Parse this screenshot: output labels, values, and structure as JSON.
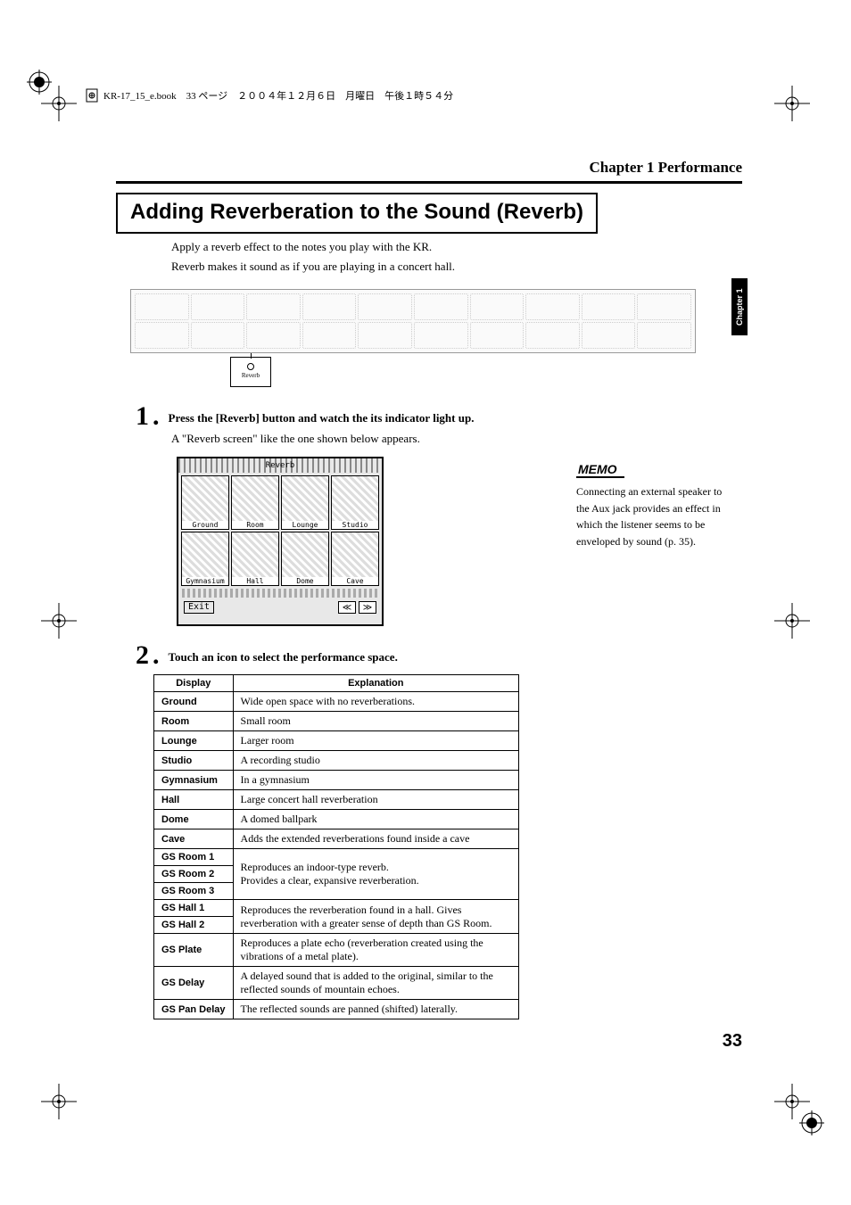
{
  "header_line": "KR-17_15_e.book　33 ページ　２００４年１２月６日　月曜日　午後１時５４分",
  "chapter_heading": "Chapter 1 Performance",
  "main_title": "Adding Reverberation to the Sound (Reverb)",
  "intro_lines": [
    "Apply a reverb effect to the notes you play with the KR.",
    "Reverb makes it sound as if you are playing in a concert hall."
  ],
  "reverb_button_label": "Reverb",
  "steps": {
    "s1_num": "1",
    "s1_text": "Press the [Reverb] button and watch the its indicator light up.",
    "s1_sub": "A \"Reverb screen\" like the one shown below appears.",
    "s2_num": "2",
    "s2_text": "Touch an icon to select the performance space."
  },
  "reverb_screen": {
    "title": "Reverb",
    "cells": [
      "Ground",
      "Room",
      "Lounge",
      "Studio",
      "Gymnasium",
      "Hall",
      "Dome",
      "Cave"
    ],
    "exit": "Exit",
    "prev": "≪",
    "next": "≫"
  },
  "table": {
    "headers": {
      "display": "Display",
      "explanation": "Explanation"
    },
    "rows": [
      {
        "d": "Ground",
        "e": "Wide open space with no reverberations."
      },
      {
        "d": "Room",
        "e": "Small room"
      },
      {
        "d": "Lounge",
        "e": "Larger room"
      },
      {
        "d": "Studio",
        "e": "A recording studio"
      },
      {
        "d": "Gymnasium",
        "e": "In a gymnasium"
      },
      {
        "d": "Hall",
        "e": "Large concert hall reverberation"
      },
      {
        "d": "Dome",
        "e": "A domed ballpark"
      },
      {
        "d": "Cave",
        "e": "Adds the extended reverberations found inside a cave"
      }
    ],
    "gs_group": {
      "rooms": [
        "GS Room 1",
        "GS Room 2",
        "GS Room 3"
      ],
      "rooms_expl": "Reproduces an indoor-type reverb.\nProvides a clear, expansive reverberation.",
      "halls": [
        "GS Hall 1",
        "GS Hall 2"
      ],
      "halls_expl": "Reproduces the reverberation found in a hall. Gives reverberation with a greater sense of depth than GS Room.",
      "plate_d": "GS Plate",
      "plate_e": "Reproduces a plate echo (reverberation created using the vibrations of a metal plate).",
      "delay_d": "GS Delay",
      "delay_e": "A delayed sound that is added to the original, similar to the reflected sounds of mountain echoes.",
      "pan_d": "GS Pan Delay",
      "pan_e": "The reflected sounds are panned (shifted) laterally."
    }
  },
  "memo": {
    "label": "MEMO",
    "text": "Connecting an external speaker to the Aux jack provides an effect in which the listener seems to be enveloped by sound (p. 35)."
  },
  "side_tab": "Chapter 1",
  "page_number": "33"
}
